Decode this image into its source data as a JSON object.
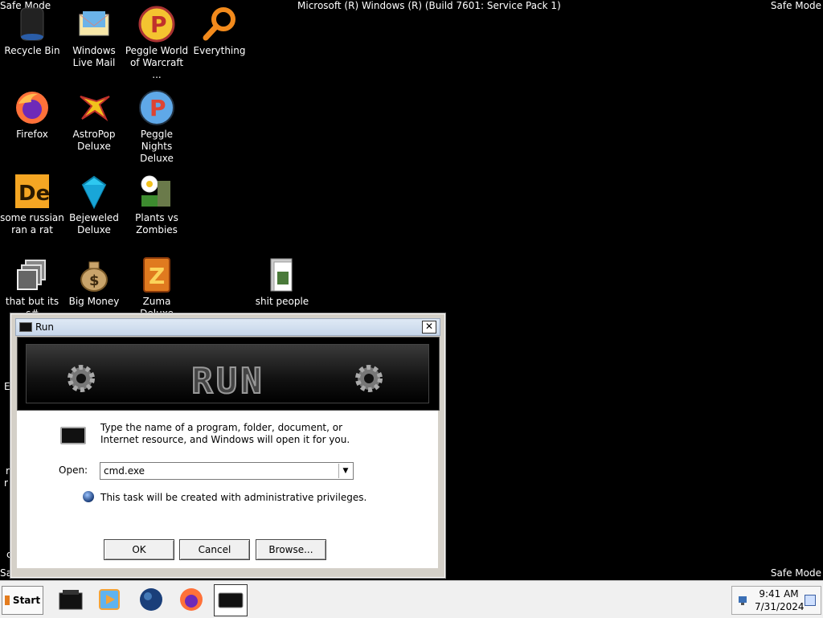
{
  "screen": {
    "safe_mode_label": "Safe Mode",
    "safe_mode_top_left": "Safe Mode",
    "build_string": "Microsoft (R) Windows (R) (Build 7601: Service Pack 1)"
  },
  "desktop": {
    "icons": [
      {
        "label": "Recycle Bin",
        "icon": "recycle-bin-icon"
      },
      {
        "label": "Windows Live Mail",
        "icon": "windows-live-mail-icon"
      },
      {
        "label": "Peggle World of Warcraft ...",
        "icon": "peggle-wow-icon"
      },
      {
        "label": "Everything",
        "icon": "everything-search-icon"
      },
      {
        "label": "Firefox",
        "icon": "firefox-icon"
      },
      {
        "label": "AstroPop Deluxe",
        "icon": "astropop-icon"
      },
      {
        "label": "Peggle Nights Deluxe",
        "icon": "peggle-nights-icon"
      },
      {
        "label": "some russian ran a rat",
        "icon": "de-app-icon"
      },
      {
        "label": "Bejeweled Deluxe",
        "icon": "bejeweled-gem-icon"
      },
      {
        "label": "Plants vs Zombies",
        "icon": "plants-vs-zombies-icon"
      },
      {
        "label": "that but its c#",
        "icon": "stacked-windows-icon"
      },
      {
        "label": "Big Money",
        "icon": "money-bag-icon"
      },
      {
        "label": "Zuma Deluxe",
        "icon": "zuma-icon"
      },
      {
        "label": "shit people",
        "icon": "folder-icon"
      }
    ],
    "stray_letters": [
      "E",
      "r",
      "r",
      "c"
    ]
  },
  "run_dialog": {
    "title": "Run",
    "close_glyph": "✕",
    "banner_text": "RUN",
    "description": "Type the name of a program, folder, document, or Internet resource, and Windows will open it for you.",
    "open_label": "Open:",
    "open_value": "cmd.exe",
    "admin_note": "This task will be created with administrative privileges.",
    "buttons": {
      "ok": "OK",
      "cancel": "Cancel",
      "browse": "Browse..."
    }
  },
  "taskbar": {
    "start_label": "Start",
    "pinned": [
      "terminal-icon",
      "media-player-icon",
      "globe-icon",
      "firefox-icon",
      "run-window-icon"
    ],
    "clock_time": "9:41 AM",
    "clock_date": "7/31/2024"
  }
}
